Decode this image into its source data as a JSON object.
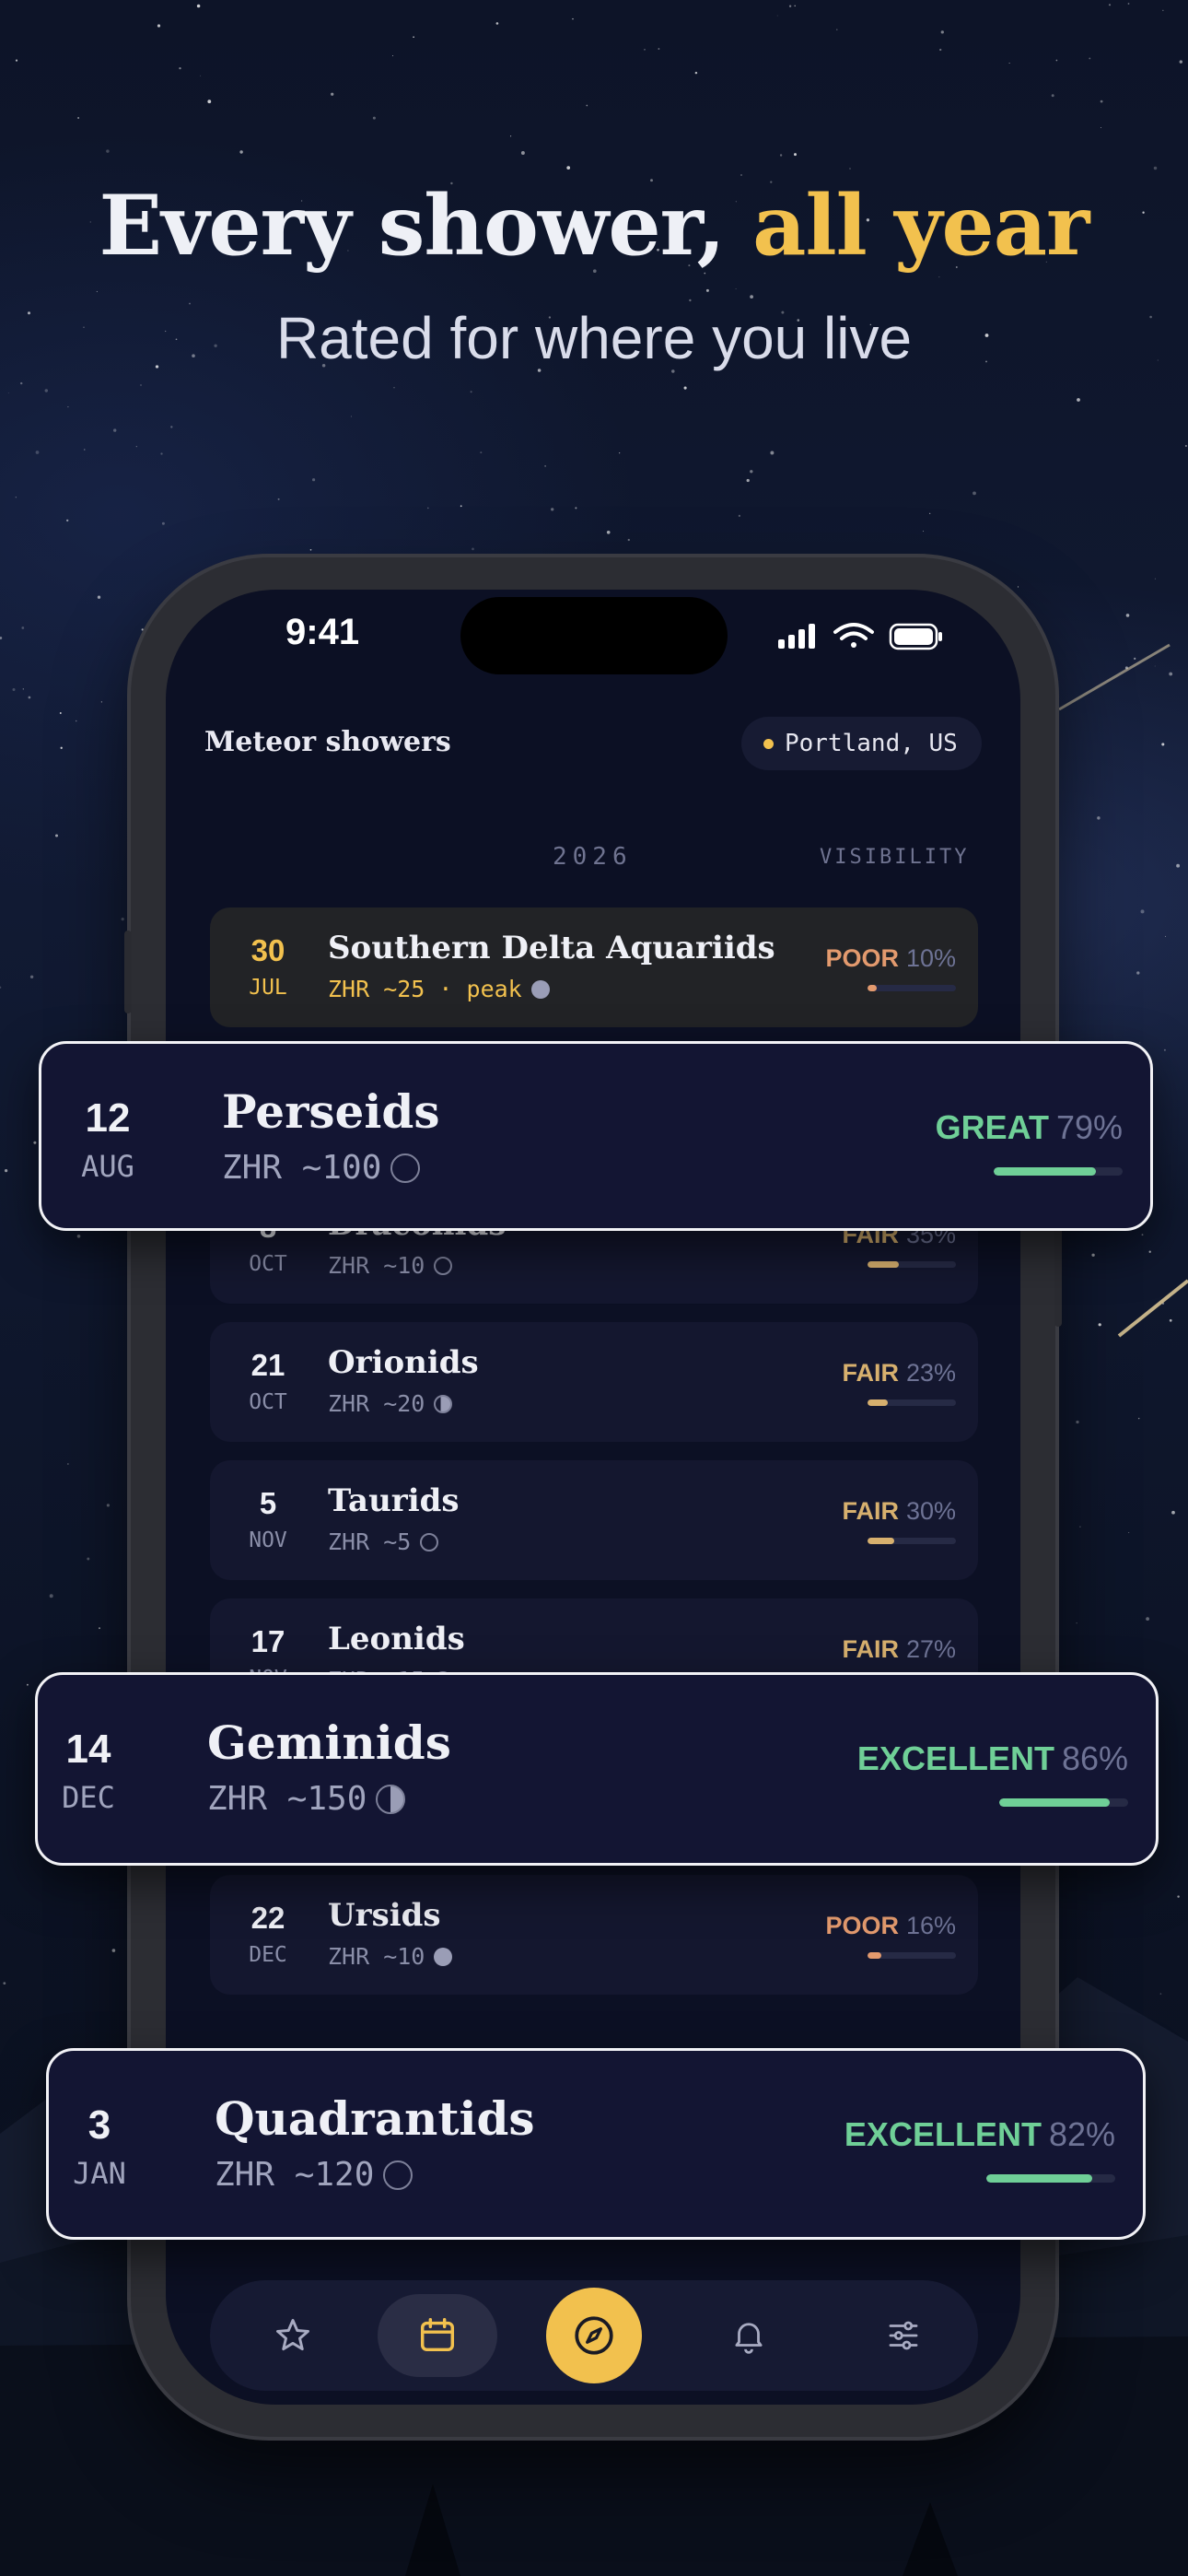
{
  "promo": {
    "headline_main": "Every shower,",
    "headline_accent": "all year",
    "subhead": "Rated for where you live"
  },
  "status_bar": {
    "time": "9:41"
  },
  "header": {
    "title": "Meteor showers",
    "location": "Portland, US"
  },
  "columns": {
    "year": "2026",
    "visibility": "VISIBILITY"
  },
  "colors": {
    "accent": "#f2c14e",
    "poor": "#e39a6e",
    "fair": "#d7b06e",
    "great": "#6fcf97",
    "excellent": "#6fcf97"
  },
  "showers": [
    {
      "day": "30",
      "month": "JUL",
      "name": "Southern Delta Aquariids",
      "zhr": "ZHR ~25 · peak",
      "moon": "full",
      "rating": "POOR",
      "percent": "10%",
      "level": 0.1,
      "state": "past"
    },
    {
      "day": "12",
      "month": "AUG",
      "name": "Perseids",
      "zhr": "ZHR ~100",
      "moon": "new",
      "rating": "GREAT",
      "percent": "79%",
      "level": 0.79,
      "state": "highlight"
    },
    {
      "day": "8",
      "month": "OCT",
      "name": "Draconids",
      "zhr": "ZHR ~10",
      "moon": "new",
      "rating": "FAIR",
      "percent": "35%",
      "level": 0.35,
      "state": "normal"
    },
    {
      "day": "21",
      "month": "OCT",
      "name": "Orionids",
      "zhr": "ZHR ~20",
      "moon": "gibbous",
      "rating": "FAIR",
      "percent": "23%",
      "level": 0.23,
      "state": "normal"
    },
    {
      "day": "5",
      "month": "NOV",
      "name": "Taurids",
      "zhr": "ZHR ~5",
      "moon": "new",
      "rating": "FAIR",
      "percent": "30%",
      "level": 0.3,
      "state": "normal"
    },
    {
      "day": "17",
      "month": "NOV",
      "name": "Leonids",
      "zhr": "ZHR ~15",
      "moon": "new",
      "rating": "FAIR",
      "percent": "27%",
      "level": 0.27,
      "state": "normal"
    },
    {
      "day": "14",
      "month": "DEC",
      "name": "Geminids",
      "zhr": "ZHR ~150",
      "moon": "quarter",
      "rating": "EXCELLENT",
      "percent": "86%",
      "level": 0.86,
      "state": "highlight"
    },
    {
      "day": "22",
      "month": "DEC",
      "name": "Ursids",
      "zhr": "ZHR ~10",
      "moon": "full",
      "rating": "POOR",
      "percent": "16%",
      "level": 0.16,
      "state": "normal"
    },
    {
      "day": "3",
      "month": "JAN",
      "name": "Quadrantids",
      "zhr": "ZHR ~120",
      "moon": "new",
      "rating": "EXCELLENT",
      "percent": "82%",
      "level": 0.82,
      "state": "highlight"
    }
  ],
  "tab_bar": {
    "items": [
      {
        "icon": "star-icon",
        "active": false
      },
      {
        "icon": "calendar-icon",
        "active": true
      },
      {
        "icon": "compass-icon",
        "active": false,
        "primary": true
      },
      {
        "icon": "bell-icon",
        "active": false
      },
      {
        "icon": "sliders-icon",
        "active": false
      }
    ]
  }
}
